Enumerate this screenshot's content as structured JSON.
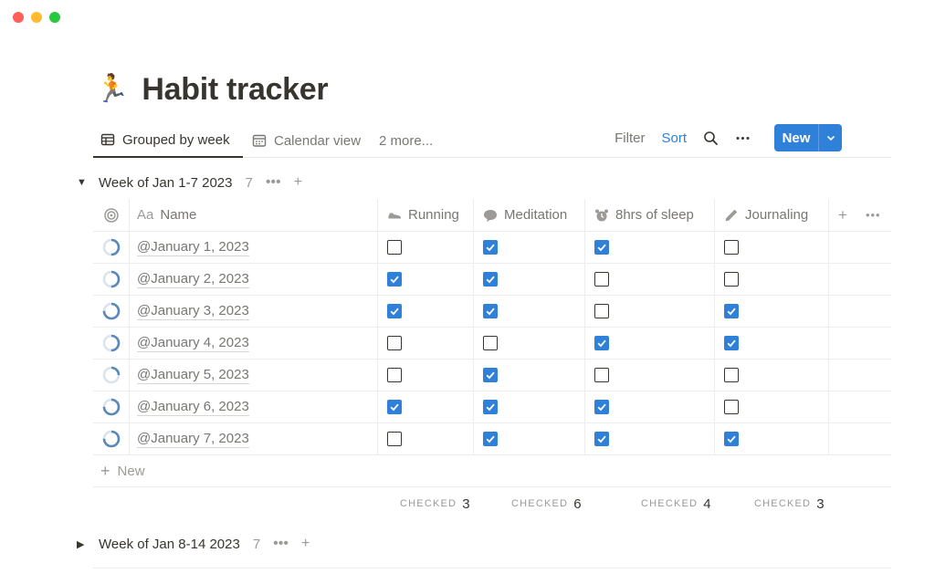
{
  "window": {
    "buttons": [
      {
        "name": "close",
        "color": "#ff5f57"
      },
      {
        "name": "minimize",
        "color": "#febc2e"
      },
      {
        "name": "zoom",
        "color": "#28c840"
      }
    ]
  },
  "page": {
    "icon": "runner-emoji",
    "emoji": "🏃",
    "title": "Habit tracker"
  },
  "views": {
    "tabs": [
      {
        "label": "Grouped by week",
        "icon": "table-icon"
      },
      {
        "label": "Calendar view",
        "icon": "calendar-icon"
      }
    ],
    "more": "2 more...",
    "filter": "Filter",
    "sort": "Sort",
    "new_label": "New"
  },
  "groups": [
    {
      "title": "Week of Jan 1-7 2023",
      "count": "7",
      "expanded": true
    },
    {
      "title": "Week of Jan 8-14 2023",
      "count": "7",
      "expanded": false
    }
  ],
  "table": {
    "columns": [
      {
        "label": "Name",
        "prefix": "Aa",
        "icon": "title-icon"
      },
      {
        "label": "Running",
        "icon": "sneaker-icon"
      },
      {
        "label": "Meditation",
        "icon": "speech-bubble-icon"
      },
      {
        "label": "8hrs of sleep",
        "icon": "alarm-clock-icon"
      },
      {
        "label": "Journaling",
        "icon": "pencil-icon"
      }
    ],
    "rows": [
      {
        "name": "@January 1, 2023",
        "progress": 0.5,
        "checks": [
          false,
          true,
          true,
          false
        ]
      },
      {
        "name": "@January 2, 2023",
        "progress": 0.5,
        "checks": [
          true,
          true,
          false,
          false
        ]
      },
      {
        "name": "@January 3, 2023",
        "progress": 0.75,
        "checks": [
          true,
          true,
          false,
          true
        ]
      },
      {
        "name": "@January 4, 2023",
        "progress": 0.5,
        "checks": [
          false,
          false,
          true,
          true
        ]
      },
      {
        "name": "@January 5, 2023",
        "progress": 0.25,
        "checks": [
          false,
          true,
          false,
          false
        ]
      },
      {
        "name": "@January 6, 2023",
        "progress": 0.75,
        "checks": [
          true,
          true,
          true,
          false
        ]
      },
      {
        "name": "@January 7, 2023",
        "progress": 0.75,
        "checks": [
          false,
          true,
          true,
          true
        ]
      }
    ],
    "add_row_label": "New",
    "calculations": [
      {
        "label": "CHECKED",
        "value": "3"
      },
      {
        "label": "CHECKED",
        "value": "6"
      },
      {
        "label": "CHECKED",
        "value": "4"
      },
      {
        "label": "CHECKED",
        "value": "3"
      }
    ]
  },
  "colors": {
    "accent": "#2f80d8",
    "ring": "#5b88b9",
    "ring_track": "#dbe3ec",
    "text": "#37352f",
    "muted": "#787774"
  }
}
